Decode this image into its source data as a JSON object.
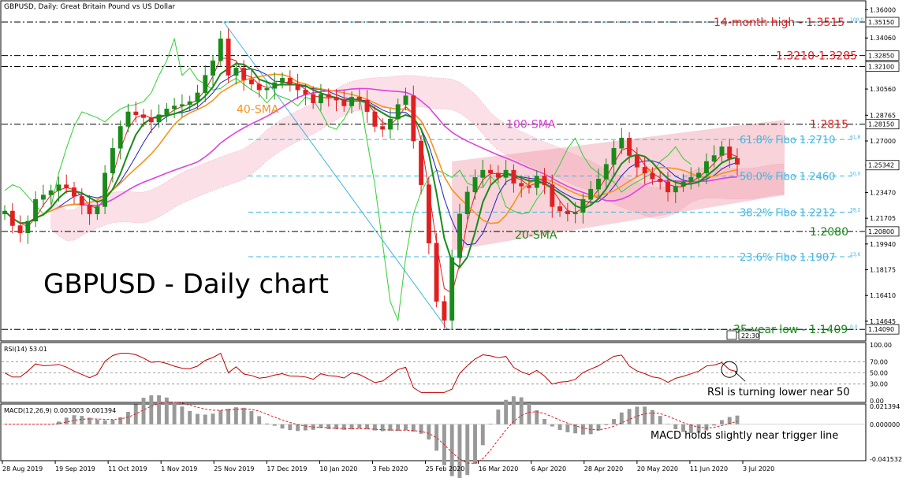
{
  "chart_data": {
    "type": "line",
    "header": "GBPUSD, Daily:  Great Britain Pound vs US Dollar",
    "title": "GBPUSD - Daily chart",
    "x_labels": [
      "28 Aug 2019",
      "19 Sep 2019",
      "11 Oct 2019",
      "1 Nov 2019",
      "25 Nov 2019",
      "17 Dec 2019",
      "10 Jan 2020",
      "3 Feb 2020",
      "25 Feb 2020",
      "16 Mar 2020",
      "6 Apr 2020",
      "28 Apr 2020",
      "20 May 2020",
      "11 Jun 2020",
      "3 Jul 2020"
    ],
    "ylim": [
      1.134,
      1.365
    ],
    "y_ticks": [
      "1.36000",
      "1.34060",
      "1.30560",
      "1.28765",
      "1.27000",
      "1.25342",
      "1.23470",
      "1.21705",
      "1.19940",
      "1.18175",
      "1.16410",
      "1.14645"
    ],
    "y_ticks_values": [
      1.36,
      1.3406,
      1.3056,
      1.28765,
      1.27,
      1.25342,
      1.2347,
      1.21705,
      1.1994,
      1.18175,
      1.1641,
      1.14645
    ],
    "price_boxes": [
      {
        "label": "1.35150",
        "value": 1.3515
      },
      {
        "label": "1.32850",
        "value": 1.3285
      },
      {
        "label": "1.32100",
        "value": 1.321
      },
      {
        "label": "1.28150",
        "value": 1.2815
      },
      {
        "label": "1.25342",
        "value": 1.25342
      },
      {
        "label": "1.20800",
        "value": 1.208
      },
      {
        "label": "1.14090",
        "value": 1.1409
      }
    ],
    "horizontal_levels": [
      {
        "value": 1.3515,
        "label": "14-month high - 1.3515",
        "color": "#e02020"
      },
      {
        "value": 1.3285,
        "label": "1.3210-1.3285",
        "color": "#e02020"
      },
      {
        "value": 1.321,
        "label": "",
        "color": "#e02020"
      },
      {
        "value": 1.2815,
        "label": "1.2815",
        "color": "#e02020"
      },
      {
        "value": 1.208,
        "label": "1.2080",
        "color": "#1a8a1a"
      },
      {
        "value": 1.1409,
        "label": "35-year low - 1.1409",
        "color": "#1a8a1a"
      }
    ],
    "fibonacci": [
      {
        "value": 1.3515,
        "label": "",
        "tag": "100.0"
      },
      {
        "value": 1.271,
        "label": "61.8% Fibo 1.2710",
        "tag": "61.8"
      },
      {
        "value": 1.246,
        "label": "50.0% Fibo 1.2460",
        "tag": "50.0"
      },
      {
        "value": 1.2212,
        "label": "38.2% Fibo 1.2212",
        "tag": "38.2"
      },
      {
        "value": 1.1907,
        "label": "23.6% Fibo 1.1907",
        "tag": "23.6"
      },
      {
        "value": 1.1409,
        "label": "",
        "tag": "0.0"
      }
    ],
    "ma_labels": [
      {
        "name": "40-SMA",
        "color": "#f7931e"
      },
      {
        "name": "100-SMA",
        "color": "#e040e0"
      },
      {
        "name": "20-SMA",
        "color": "#1a8a1a"
      }
    ],
    "series": [
      {
        "name": "GBPUSD",
        "values": [
          1.222,
          1.212,
          1.207,
          1.215,
          1.23,
          1.233,
          1.236,
          1.24,
          1.238,
          1.232,
          1.226,
          1.22,
          1.225,
          1.248,
          1.265,
          1.28,
          1.29,
          1.288,
          1.286,
          1.283,
          1.288,
          1.292,
          1.294,
          1.295,
          1.297,
          1.303,
          1.315,
          1.325,
          1.34,
          1.315,
          1.32,
          1.312,
          1.309,
          1.305,
          1.306,
          1.31,
          1.313,
          1.309,
          1.305,
          1.302,
          1.296,
          1.302,
          1.3,
          1.298,
          1.294,
          1.3,
          1.298,
          1.29,
          1.28,
          1.278,
          1.285,
          1.295,
          1.301,
          1.27,
          1.24,
          1.2,
          1.16,
          1.147,
          1.19,
          1.22,
          1.235,
          1.245,
          1.25,
          1.248,
          1.245,
          1.25,
          1.241,
          1.239,
          1.238,
          1.246,
          1.24,
          1.225,
          1.222,
          1.22,
          1.221,
          1.23,
          1.237,
          1.244,
          1.254,
          1.265,
          1.272,
          1.26,
          1.252,
          1.248,
          1.244,
          1.242,
          1.235,
          1.239,
          1.242,
          1.245,
          1.248,
          1.256,
          1.26,
          1.266,
          1.258,
          1.254
        ]
      }
    ],
    "rsi": {
      "label": "RSI(14) 53.01",
      "ylim": [
        0,
        100
      ],
      "ticks": [
        "100.00",
        "70.00",
        "50.00",
        "30.00",
        "0.00"
      ],
      "annotation": "RSI is turning lower near 50"
    },
    "macd": {
      "label": "MACD(12,26,9) 0.003003 0.001394",
      "ticks": [
        "0.021394",
        "0.000000",
        "-0.041532"
      ],
      "annotation": "MACD holds slightly near trigger line"
    },
    "time_box": "22:30",
    "grid": false,
    "colors": {
      "price_up": "#1a8a1a",
      "price_down": "#e02020",
      "sma20": "#1a8a1a",
      "sma40": "#f7931e",
      "sma100": "#e040e0",
      "tenkan": "#e02020",
      "kijun": "#2020c0",
      "chikou": "#30d030",
      "cloud": "#f090a8",
      "channel": "#f6c4cc",
      "fibo": "#3fb6e0",
      "diagonal": "#3fb6e0",
      "rsi": "#c00000",
      "macd_signal": "#e02020",
      "macd_hist": "#999999"
    }
  }
}
